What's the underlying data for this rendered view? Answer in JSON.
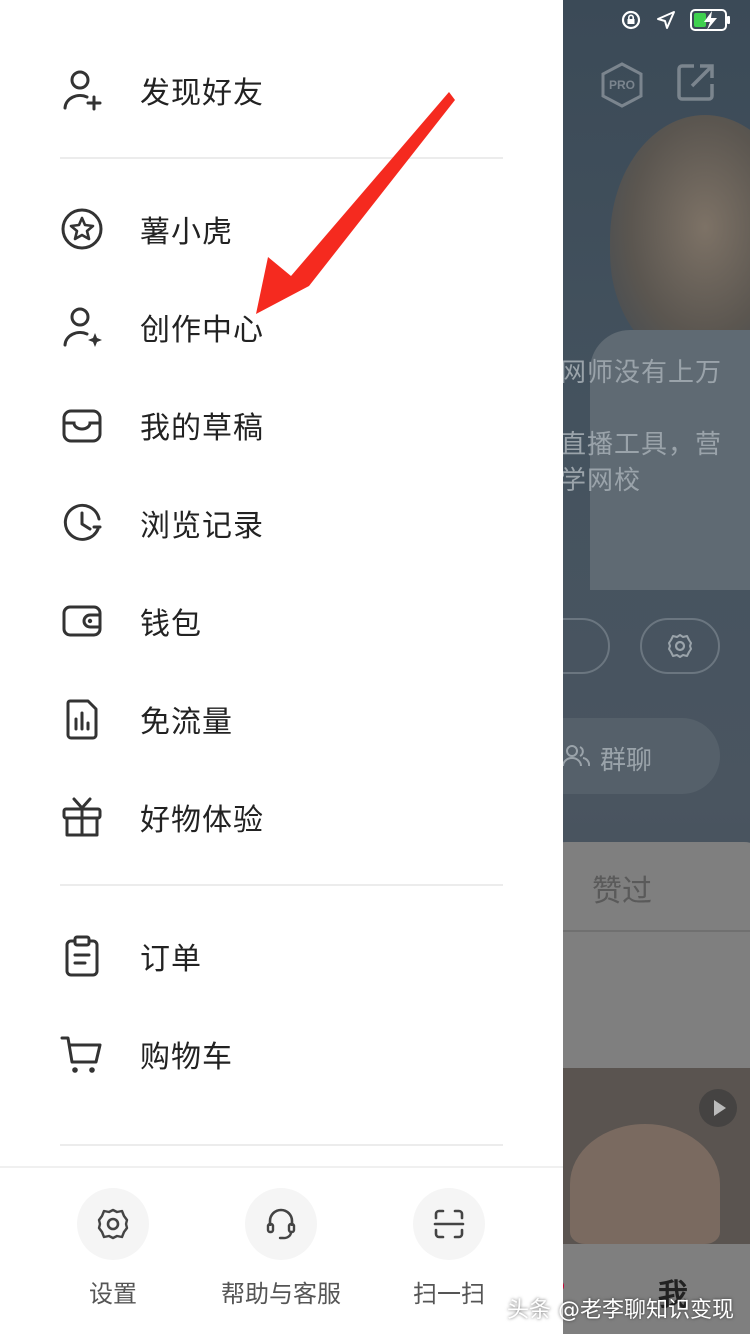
{
  "drawer": {
    "items": [
      {
        "label": "发现好友",
        "icon": "add-friend-icon"
      },
      {
        "label": "薯小虎",
        "icon": "star-badge-icon"
      },
      {
        "label": "创作中心",
        "icon": "creator-icon"
      },
      {
        "label": "我的草稿",
        "icon": "drafts-icon"
      },
      {
        "label": "浏览记录",
        "icon": "history-icon"
      },
      {
        "label": "钱包",
        "icon": "wallet-icon"
      },
      {
        "label": "免流量",
        "icon": "data-sim-icon"
      },
      {
        "label": "好物体验",
        "icon": "gift-icon"
      },
      {
        "label": "订单",
        "icon": "order-icon"
      },
      {
        "label": "购物车",
        "icon": "cart-icon"
      }
    ],
    "bottom": {
      "settings_label": "设置",
      "help_label": "帮助与客服",
      "scan_label": "扫一扫"
    }
  },
  "background": {
    "pro_badge": "PRO",
    "bio_lines": [
      "网师没有上万",
      "直播工具，营",
      "学网校"
    ],
    "group_chat_label": "群聊",
    "liked_tab": "赞过",
    "me_tab": "我"
  },
  "watermark": "头条 @老李聊知识变现",
  "colors": {
    "drawer_bg": "#ffffff",
    "text": "#222222",
    "annotation_arrow": "#f52a1f"
  }
}
